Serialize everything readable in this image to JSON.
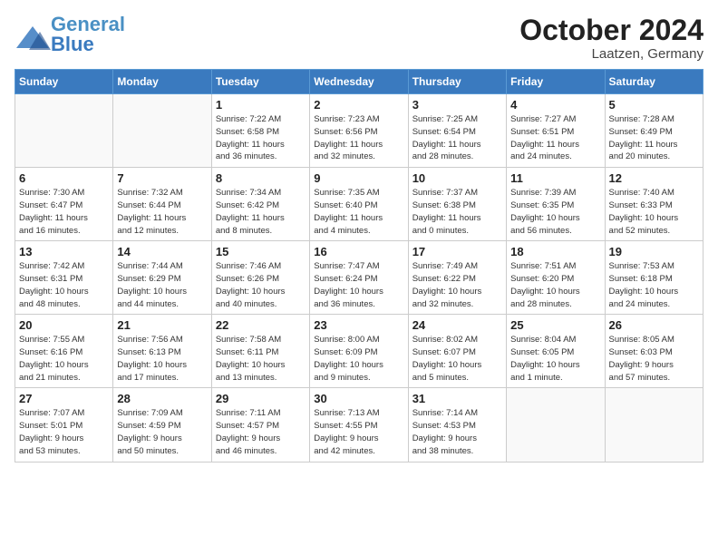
{
  "header": {
    "logo_line1": "General",
    "logo_line2": "Blue",
    "month": "October 2024",
    "location": "Laatzen, Germany"
  },
  "weekdays": [
    "Sunday",
    "Monday",
    "Tuesday",
    "Wednesday",
    "Thursday",
    "Friday",
    "Saturday"
  ],
  "weeks": [
    [
      {
        "day": "",
        "info": ""
      },
      {
        "day": "",
        "info": ""
      },
      {
        "day": "1",
        "info": "Sunrise: 7:22 AM\nSunset: 6:58 PM\nDaylight: 11 hours\nand 36 minutes."
      },
      {
        "day": "2",
        "info": "Sunrise: 7:23 AM\nSunset: 6:56 PM\nDaylight: 11 hours\nand 32 minutes."
      },
      {
        "day": "3",
        "info": "Sunrise: 7:25 AM\nSunset: 6:54 PM\nDaylight: 11 hours\nand 28 minutes."
      },
      {
        "day": "4",
        "info": "Sunrise: 7:27 AM\nSunset: 6:51 PM\nDaylight: 11 hours\nand 24 minutes."
      },
      {
        "day": "5",
        "info": "Sunrise: 7:28 AM\nSunset: 6:49 PM\nDaylight: 11 hours\nand 20 minutes."
      }
    ],
    [
      {
        "day": "6",
        "info": "Sunrise: 7:30 AM\nSunset: 6:47 PM\nDaylight: 11 hours\nand 16 minutes."
      },
      {
        "day": "7",
        "info": "Sunrise: 7:32 AM\nSunset: 6:44 PM\nDaylight: 11 hours\nand 12 minutes."
      },
      {
        "day": "8",
        "info": "Sunrise: 7:34 AM\nSunset: 6:42 PM\nDaylight: 11 hours\nand 8 minutes."
      },
      {
        "day": "9",
        "info": "Sunrise: 7:35 AM\nSunset: 6:40 PM\nDaylight: 11 hours\nand 4 minutes."
      },
      {
        "day": "10",
        "info": "Sunrise: 7:37 AM\nSunset: 6:38 PM\nDaylight: 11 hours\nand 0 minutes."
      },
      {
        "day": "11",
        "info": "Sunrise: 7:39 AM\nSunset: 6:35 PM\nDaylight: 10 hours\nand 56 minutes."
      },
      {
        "day": "12",
        "info": "Sunrise: 7:40 AM\nSunset: 6:33 PM\nDaylight: 10 hours\nand 52 minutes."
      }
    ],
    [
      {
        "day": "13",
        "info": "Sunrise: 7:42 AM\nSunset: 6:31 PM\nDaylight: 10 hours\nand 48 minutes."
      },
      {
        "day": "14",
        "info": "Sunrise: 7:44 AM\nSunset: 6:29 PM\nDaylight: 10 hours\nand 44 minutes."
      },
      {
        "day": "15",
        "info": "Sunrise: 7:46 AM\nSunset: 6:26 PM\nDaylight: 10 hours\nand 40 minutes."
      },
      {
        "day": "16",
        "info": "Sunrise: 7:47 AM\nSunset: 6:24 PM\nDaylight: 10 hours\nand 36 minutes."
      },
      {
        "day": "17",
        "info": "Sunrise: 7:49 AM\nSunset: 6:22 PM\nDaylight: 10 hours\nand 32 minutes."
      },
      {
        "day": "18",
        "info": "Sunrise: 7:51 AM\nSunset: 6:20 PM\nDaylight: 10 hours\nand 28 minutes."
      },
      {
        "day": "19",
        "info": "Sunrise: 7:53 AM\nSunset: 6:18 PM\nDaylight: 10 hours\nand 24 minutes."
      }
    ],
    [
      {
        "day": "20",
        "info": "Sunrise: 7:55 AM\nSunset: 6:16 PM\nDaylight: 10 hours\nand 21 minutes."
      },
      {
        "day": "21",
        "info": "Sunrise: 7:56 AM\nSunset: 6:13 PM\nDaylight: 10 hours\nand 17 minutes."
      },
      {
        "day": "22",
        "info": "Sunrise: 7:58 AM\nSunset: 6:11 PM\nDaylight: 10 hours\nand 13 minutes."
      },
      {
        "day": "23",
        "info": "Sunrise: 8:00 AM\nSunset: 6:09 PM\nDaylight: 10 hours\nand 9 minutes."
      },
      {
        "day": "24",
        "info": "Sunrise: 8:02 AM\nSunset: 6:07 PM\nDaylight: 10 hours\nand 5 minutes."
      },
      {
        "day": "25",
        "info": "Sunrise: 8:04 AM\nSunset: 6:05 PM\nDaylight: 10 hours\nand 1 minute."
      },
      {
        "day": "26",
        "info": "Sunrise: 8:05 AM\nSunset: 6:03 PM\nDaylight: 9 hours\nand 57 minutes."
      }
    ],
    [
      {
        "day": "27",
        "info": "Sunrise: 7:07 AM\nSunset: 5:01 PM\nDaylight: 9 hours\nand 53 minutes."
      },
      {
        "day": "28",
        "info": "Sunrise: 7:09 AM\nSunset: 4:59 PM\nDaylight: 9 hours\nand 50 minutes."
      },
      {
        "day": "29",
        "info": "Sunrise: 7:11 AM\nSunset: 4:57 PM\nDaylight: 9 hours\nand 46 minutes."
      },
      {
        "day": "30",
        "info": "Sunrise: 7:13 AM\nSunset: 4:55 PM\nDaylight: 9 hours\nand 42 minutes."
      },
      {
        "day": "31",
        "info": "Sunrise: 7:14 AM\nSunset: 4:53 PM\nDaylight: 9 hours\nand 38 minutes."
      },
      {
        "day": "",
        "info": ""
      },
      {
        "day": "",
        "info": ""
      }
    ]
  ]
}
